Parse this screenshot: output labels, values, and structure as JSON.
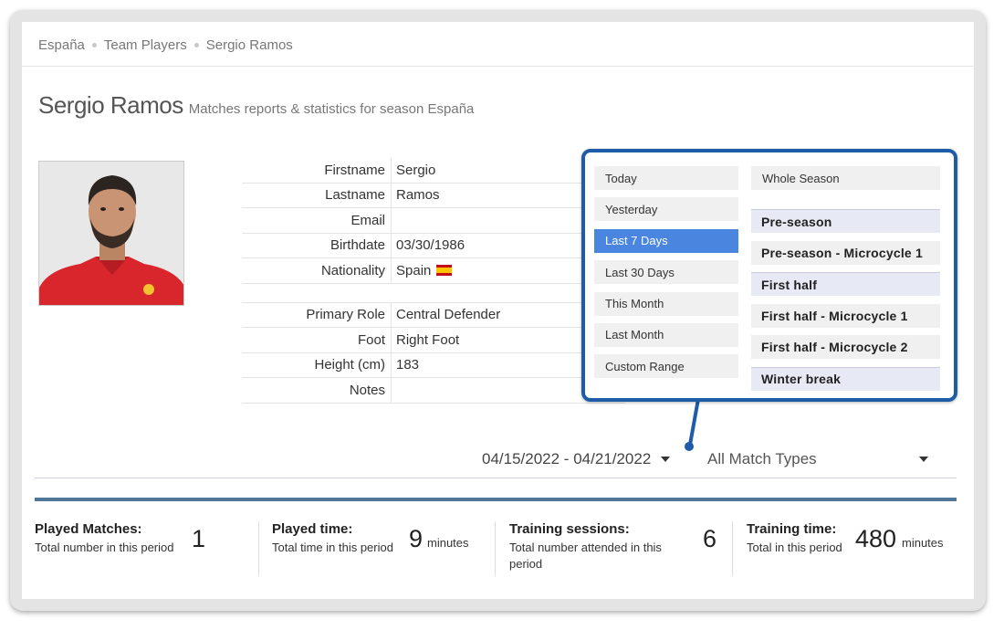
{
  "breadcrumb": [
    "España",
    "Team Players",
    "Sergio Ramos"
  ],
  "header": {
    "name": "Sergio Ramos",
    "subtitle": "Matches reports & statistics for season España"
  },
  "player_info": {
    "rows": [
      {
        "label": "Firstname",
        "value": "Sergio"
      },
      {
        "label": "Lastname",
        "value": "Ramos"
      },
      {
        "label": "Email",
        "value": ""
      },
      {
        "label": "Birthdate",
        "value": "03/30/1986"
      },
      {
        "label": "Nationality",
        "value": "Spain"
      }
    ],
    "rows2": [
      {
        "label": "Primary Role",
        "value": "Central Defender"
      },
      {
        "label": "Foot",
        "value": "Right Foot"
      },
      {
        "label": "Height (cm)",
        "value": "183"
      },
      {
        "label": "Notes",
        "value": ""
      }
    ]
  },
  "filters": {
    "date_range": "04/15/2022 - 04/21/2022",
    "match_type": "All Match Types"
  },
  "date_picker": {
    "ranges": [
      "Today",
      "Yesterday",
      "Last 7 Days",
      "Last 30 Days",
      "This Month",
      "Last Month",
      "Custom Range"
    ],
    "active_range": "Last 7 Days",
    "whole_season": "Whole Season",
    "periods": [
      "Pre-season",
      "Pre-season - Microcycle 1",
      "First half",
      "First half - Microcycle 1",
      "First half - Microcycle 2",
      "Winter break"
    ]
  },
  "stats": [
    {
      "title": "Played Matches:",
      "desc": "Total number in this period",
      "value": "1",
      "unit": ""
    },
    {
      "title": "Played time:",
      "desc": "Total time in this period",
      "value": "9",
      "unit": "minutes"
    },
    {
      "title": "Training sessions:",
      "desc": "Total number attended in this period",
      "value": "6",
      "unit": ""
    },
    {
      "title": "Training time:",
      "desc": "Total in this period",
      "value": "480",
      "unit": "minutes"
    }
  ],
  "colors": {
    "accent_bar": "#50779a",
    "popup_border": "#1f5ca8",
    "active_item": "#4a86e0"
  }
}
